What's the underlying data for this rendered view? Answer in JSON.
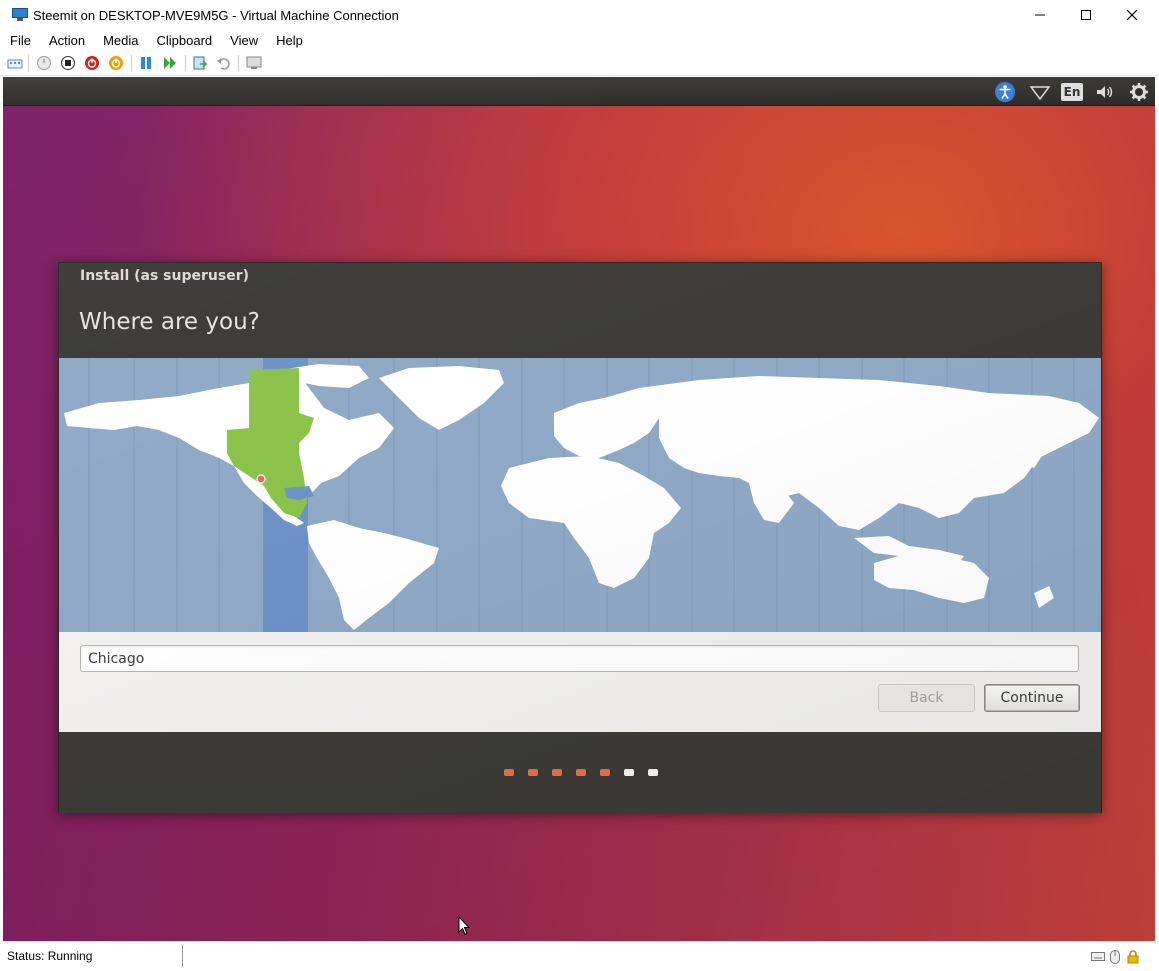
{
  "window": {
    "title": "Steemit on DESKTOP-MVE9M5G - Virtual Machine Connection"
  },
  "menubar": {
    "items": [
      "File",
      "Action",
      "Media",
      "Clipboard",
      "View",
      "Help"
    ]
  },
  "toolbar": {
    "icons": [
      "ctrl-alt-del-icon",
      "start-icon",
      "turn-off-icon",
      "shutdown-icon",
      "save-state-icon",
      "pause-icon",
      "resume-icon",
      "checkpoint-icon",
      "revert-icon",
      "enhanced-session-icon"
    ]
  },
  "ubuntu_panel": {
    "language": "En",
    "icons": [
      "accessibility-icon",
      "network-icon",
      "language-indicator",
      "volume-icon",
      "settings-gear-icon"
    ]
  },
  "installer": {
    "title": "Install (as superuser)",
    "heading": "Where are you?",
    "location_value": "Chicago",
    "back_label": "Back",
    "continue_label": "Continue",
    "progress": {
      "total": 7,
      "completed": 5,
      "active_color": "#e57245",
      "inactive_color": "#f5f5f5"
    }
  },
  "statusbar": {
    "status": "Status: Running"
  },
  "colors": {
    "ubuntu_orange": "#e95420",
    "map_ocean": "#8fa9c7",
    "timezone_highlight": "#6f95c8",
    "timezone_land": "#8bc34a",
    "land": "#ffffff"
  }
}
